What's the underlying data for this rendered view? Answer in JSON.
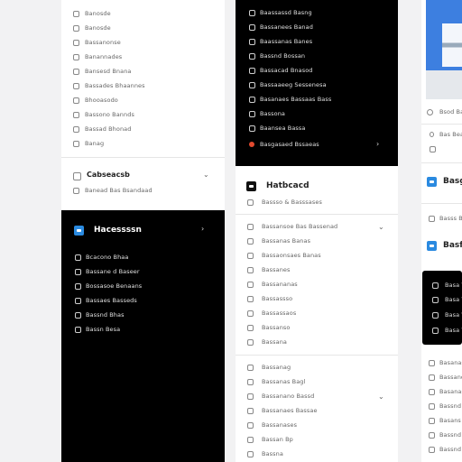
{
  "col1": {
    "top_items": [
      {
        "label": "Banosde",
        "icon": "square-icon"
      },
      {
        "label": "Banosde",
        "icon": "square-icon"
      },
      {
        "label": "Bassanonse",
        "icon": "square-icon"
      },
      {
        "label": "Banannades",
        "icon": "square-icon"
      },
      {
        "label": "Bansesd Bnana",
        "icon": "square-icon"
      },
      {
        "label": "Bassades Bhaannes",
        "icon": "square-icon"
      },
      {
        "label": "Bhooasodo",
        "icon": "square-icon"
      },
      {
        "label": "Bassono Bannds",
        "icon": "square-icon"
      },
      {
        "label": "Bassad Bhonad",
        "icon": "square-icon"
      },
      {
        "label": "Banag",
        "icon": "square-icon"
      }
    ],
    "section_title": "Cabseacsb",
    "section_item": "Banead Bas Bsandaad",
    "dark": {
      "title": "Hacessssn",
      "items": [
        "Bcacono Bhaa",
        "Bassane d Baseer",
        "Bossasoe Benaans",
        "Bassaes Basseds",
        "Bassnd Bhas",
        "Bassn Besa"
      ]
    }
  },
  "col2": {
    "dark": {
      "items": [
        "Baassassd Basng",
        "Bassanees Banad",
        "Baassanas Banes",
        "Bassnd Bossan",
        "Bassacad Bnasod",
        "Bassaaeeg Sessenesa",
        "Basanaes Bassaas Bass",
        "Bassasaeos Bsdono",
        "Bassona",
        "Baansea Bassa"
      ],
      "last_item": "Basgasaed Bssaeas",
      "last_icon": "record-icon"
    },
    "section_title": "Hatbcacd",
    "section_sub": "Bassso & Basssases",
    "group1": [
      "Bassansoe Bas Bassenad",
      "Bassanas Banas",
      "Bassaonsaes Banas",
      "Bassanes",
      "Bassananas",
      "Bassassso",
      "Bassassaos",
      "Bassanso",
      "Bassasns",
      "Bassana"
    ],
    "group2": [
      "Bassanag",
      "Bassanas Bagl",
      "Bassanano Bassd",
      "Bassanaes Bassae",
      "Bassanases",
      "Bassasn Bas",
      "Bassan Bp",
      "Bassna"
    ]
  },
  "col3": {
    "image_label": "Bsod Bangs",
    "item": "Bas Beass",
    "card_title": "Basgs",
    "row_label": "Basss Bass",
    "section_title": "Basfs",
    "dark_items": [
      "Basa Y",
      "Basa Y",
      "Basa V",
      "Basa Y"
    ],
    "list_items": [
      "Basanas",
      "Bassand",
      "Basanas",
      "Bassnd",
      "Basans",
      "Bassnd",
      "Bassnd",
      "Bassnd"
    ]
  },
  "colors": {
    "accent": "#2a8ae0",
    "dark_bg": "#000000",
    "record": "#e24a2f",
    "image_sky": "#3d7fe0"
  }
}
